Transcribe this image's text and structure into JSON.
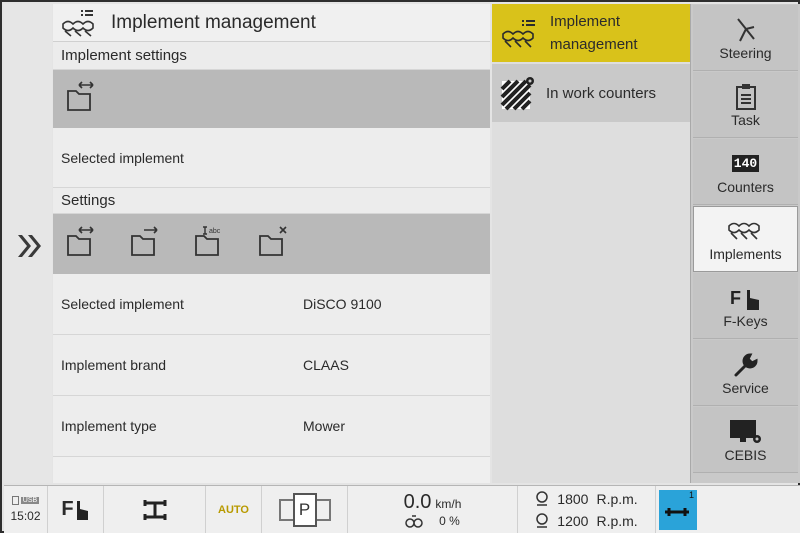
{
  "header": {
    "title": "Implement management"
  },
  "implement_settings": {
    "header": "Implement settings",
    "selected_implement_label": "Selected implement"
  },
  "settings": {
    "header": "Settings",
    "rows": [
      {
        "label": "Selected implement",
        "value": "DiSCO 9100"
      },
      {
        "label": "Implement brand",
        "value": "CLAAS"
      },
      {
        "label": "Implement type",
        "value": "Mower"
      }
    ]
  },
  "submenu": {
    "items": [
      {
        "label_line1": "Implement",
        "label_line2": "management",
        "icon": "implement-list-icon",
        "active": true
      },
      {
        "label_line1": "In work counters",
        "label_line2": "",
        "icon": "work-counter-icon",
        "active": false
      }
    ]
  },
  "nav": {
    "items": [
      {
        "label": "Steering",
        "icon": "steering-icon"
      },
      {
        "label": "Task",
        "icon": "task-clipboard-icon"
      },
      {
        "label": "Counters",
        "icon": "counters-icon",
        "icon_text": "140"
      },
      {
        "label": "Implements",
        "icon": "implement-icon",
        "active": true
      },
      {
        "label": "F-Keys",
        "icon": "fkey-hand-icon"
      },
      {
        "label": "Service",
        "icon": "wrench-icon"
      },
      {
        "label": "CEBIS",
        "icon": "cebis-monitor-icon"
      }
    ]
  },
  "status_bar": {
    "usb_label": "USB",
    "time": "15:02",
    "fkey_label": "F",
    "auto_label": "AUTO",
    "park_label": "P",
    "speed_value": "0.0",
    "speed_unit": "km/h",
    "slip_value": "0 %",
    "rpm1_value": "1800",
    "rpm2_value": "1200",
    "rpm_unit": "R.p.m.",
    "hitch_badge": "1"
  },
  "colors": {
    "accent": "#d9c21a",
    "hitch_blue": "#2aa3d9"
  }
}
